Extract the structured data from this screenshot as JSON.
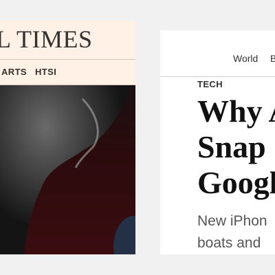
{
  "ft": {
    "masthead": "L TIMES",
    "nav": [
      "ARTS",
      "HTSI"
    ]
  },
  "wsj": {
    "nav": [
      "World",
      "B"
    ],
    "section": "TECH",
    "headline_lines": [
      "Why A",
      "Snap",
      "Googl"
    ],
    "dek_lines": [
      "New iPhon",
      "boats and"
    ]
  },
  "colors": {
    "ft_background": "#fff1e5",
    "ft_hero": "#2b0b0d",
    "page_background": "#f1f1f1"
  }
}
